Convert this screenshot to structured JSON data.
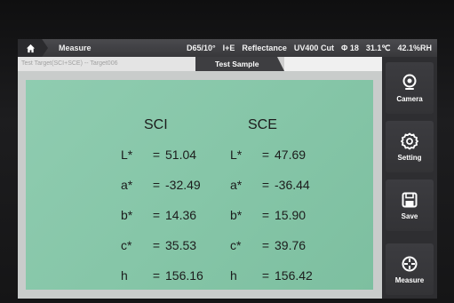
{
  "statusbar": {
    "home_icon": "home-icon",
    "breadcrumb": "Measure",
    "illuminant": "D65/10°",
    "geometry": "I+E",
    "mode": "Reflectance",
    "uv": "UV400 Cut",
    "aperture": "Φ 18",
    "temperature": "31.1℃",
    "humidity": "42.1%RH"
  },
  "tabs": {
    "target": "Test Target(SCI+SCE) -- Target006",
    "sample": "Test Sample"
  },
  "results": {
    "sci_header": "SCI",
    "sce_header": "SCE",
    "rows": [
      {
        "label": "L*",
        "eq": "=",
        "sci": "51.04",
        "sce": "47.69"
      },
      {
        "label": "a*",
        "eq": "=",
        "sci": "-32.49",
        "sce": "-36.44"
      },
      {
        "label": "b*",
        "eq": "=",
        "sci": "14.36",
        "sce": "15.90"
      },
      {
        "label": "c*",
        "eq": "=",
        "sci": "35.53",
        "sce": "39.76"
      },
      {
        "label": "h",
        "eq": "=",
        "sci": "156.16",
        "sce": "156.42"
      }
    ],
    "panel_color": "#8ac8ab"
  },
  "sidebar": {
    "camera": {
      "label": "Camera",
      "icon": "camera-icon"
    },
    "setting": {
      "label": "Setting",
      "icon": "gear-icon"
    },
    "save": {
      "label": "Save",
      "icon": "save-icon"
    },
    "measure": {
      "label": "Measure",
      "icon": "crosshair-icon"
    }
  }
}
